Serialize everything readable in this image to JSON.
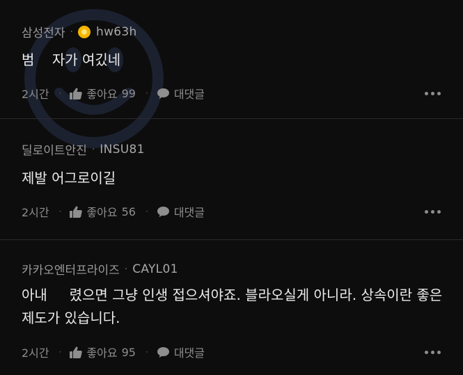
{
  "comments": [
    {
      "company": "삼성전자",
      "separator": "·",
      "username": "hw63h",
      "has_badge": true,
      "text": "범    자가 여깄네",
      "time": "2시간",
      "like_label": "좋아요",
      "like_count": "99",
      "reply_label": "대댓글"
    },
    {
      "company": "딜로이트안진",
      "separator": "·",
      "username": "INSU81",
      "has_badge": false,
      "text": "제발 어그로이길",
      "time": "2시간",
      "like_label": "좋아요",
      "like_count": "56",
      "reply_label": "대댓글"
    },
    {
      "company": "카카오엔터프라이즈",
      "separator": "·",
      "username": "CAYL01",
      "has_badge": false,
      "text": "아내     렸으면 그냥 인생 접으셔야죠. 블라오실게 아니라. 상속이란 좋은 제도가 있습니다.",
      "time": "2시간",
      "like_label": "좋아요",
      "like_count": "95",
      "reply_label": "대댓글"
    }
  ],
  "icons": {
    "like": "thumbs-up-icon",
    "reply": "speech-bubble-icon",
    "more": "more-horizontal-icon",
    "badge": "gold-badge-icon"
  },
  "colors": {
    "background": "#0d0d0d",
    "text": "#ececec",
    "muted": "#9a9a9a",
    "badge": "#f6b500"
  }
}
